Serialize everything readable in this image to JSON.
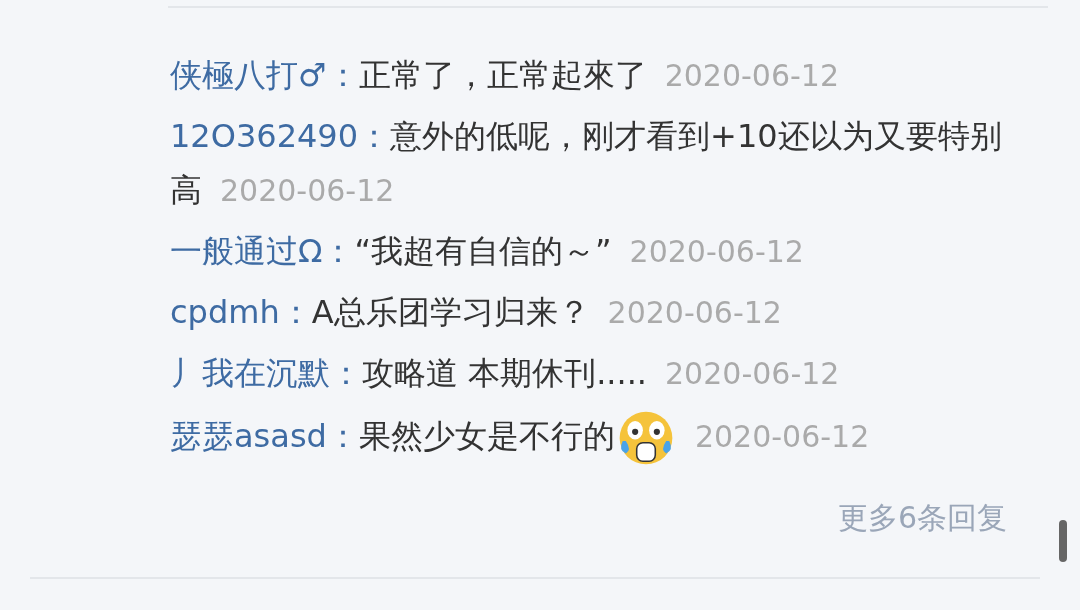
{
  "comments": [
    {
      "name": "侠極八打♂：",
      "text": "正常了，正常起來了",
      "date": "2020-06-12",
      "emoji": false
    },
    {
      "name": "12O362490：",
      "text": "意外的低呢，刚才看到+10还以为又要特别高",
      "date": "2020-06-12",
      "emoji": false
    },
    {
      "name": "一般通过Ω：",
      "text": "“我超有自信的～”",
      "date": "2020-06-12",
      "emoji": false
    },
    {
      "name": "cpdmh：",
      "text": "A总乐团学习归来？",
      "date": "2020-06-12",
      "emoji": false
    },
    {
      "name": "丿我在沉默：",
      "text": "攻略道 本期休刊.....",
      "date": "2020-06-12",
      "emoji": false
    },
    {
      "name": "瑟瑟asasd：",
      "text": "果然少女是不行的",
      "date": "2020-06-12",
      "emoji": true
    }
  ],
  "more_replies": "更多6条回复"
}
